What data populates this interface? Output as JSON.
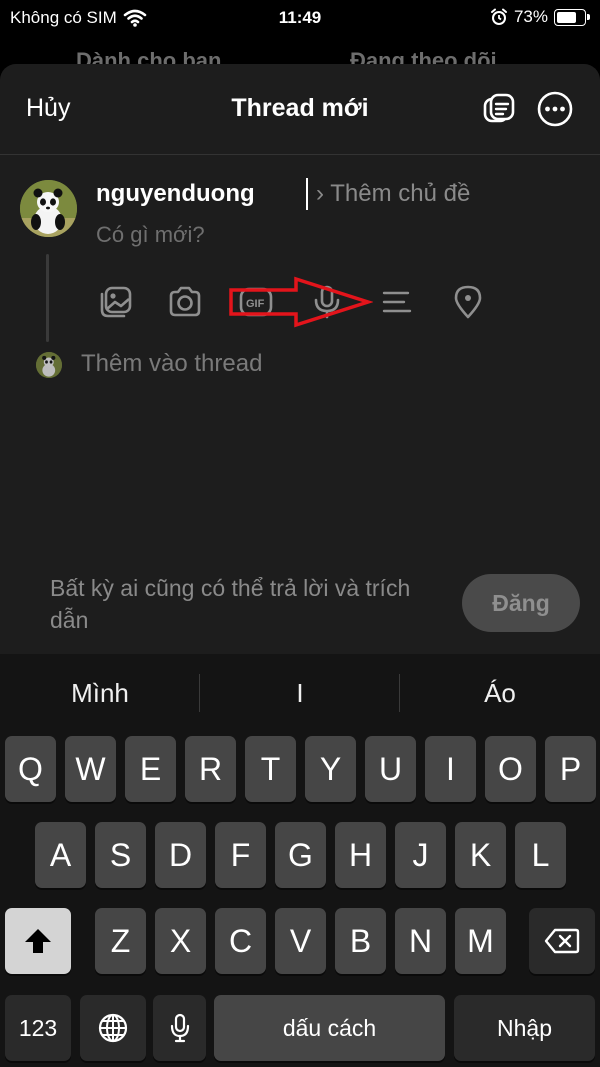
{
  "status_bar": {
    "carrier": "Không có SIM",
    "time": "11:49",
    "battery": "73%",
    "battery_level": 0.73
  },
  "background_tabs": [
    "Dành cho bạn",
    "Đang theo dõi"
  ],
  "composer": {
    "cancel_label": "Hủy",
    "title": "Thread mới",
    "username": "nguyenduong",
    "topic_placeholder": "Thêm chủ đề",
    "topic_chevron": "›",
    "text_placeholder": "Có gì mới?",
    "gif_label": "GIF",
    "add_to_thread": "Thêm vào thread",
    "reply_note": "Bất kỳ ai cũng có thể trả lời và trích dẫn",
    "post_label": "Đăng",
    "toolbar_icons": [
      "gallery-icon",
      "camera-icon",
      "gif-icon",
      "microphone-icon",
      "poll-icon",
      "location-icon"
    ]
  },
  "keyboard": {
    "suggestions": [
      "Mình",
      "I",
      "Áo"
    ],
    "row1": [
      "Q",
      "W",
      "E",
      "R",
      "T",
      "Y",
      "U",
      "I",
      "O",
      "P"
    ],
    "row2": [
      "A",
      "S",
      "D",
      "F",
      "G",
      "H",
      "J",
      "K",
      "L"
    ],
    "row3": [
      "Z",
      "X",
      "C",
      "V",
      "B",
      "N",
      "M"
    ],
    "numbers_label": "123",
    "space_label": "dấu cách",
    "return_label": "Nhập"
  },
  "annotation": {
    "color": "#e3141b"
  }
}
